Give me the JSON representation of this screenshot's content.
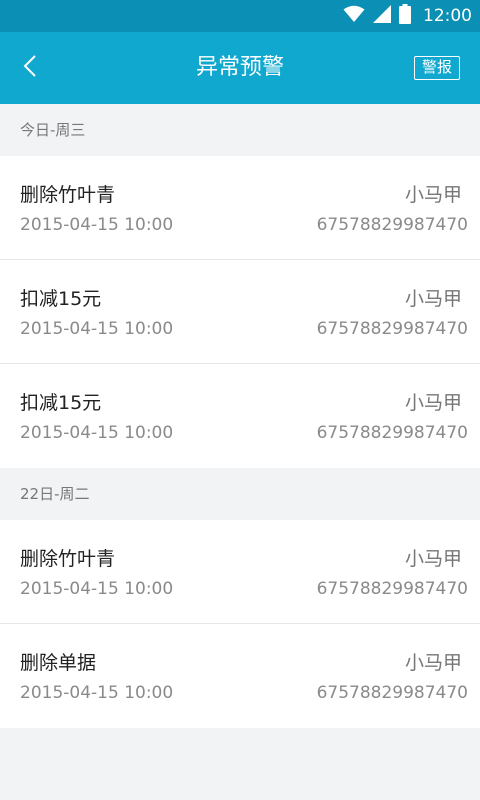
{
  "status_bar": {
    "time": "12:00",
    "icons": [
      "wifi-icon",
      "signal-icon",
      "battery-icon"
    ]
  },
  "app_bar": {
    "back_icon": "chevron-left-icon",
    "title": "异常预警",
    "action_label": "警报"
  },
  "sections": [
    {
      "header": "今日-周三",
      "items": [
        {
          "title": "删除竹叶青",
          "user": "小马甲",
          "time": "2015-04-15 10:00",
          "code": "67578829987470"
        },
        {
          "title": "扣减15元",
          "user": "小马甲",
          "time": "2015-04-15 10:00",
          "code": "67578829987470"
        },
        {
          "title": "扣减15元",
          "user": "小马甲",
          "time": "2015-04-15 10:00",
          "code": "67578829987470"
        }
      ]
    },
    {
      "header": "22日-周二",
      "items": [
        {
          "title": "删除竹叶青",
          "user": "小马甲",
          "time": "2015-04-15 10:00",
          "code": "67578829987470"
        },
        {
          "title": "删除单据",
          "user": "小马甲",
          "time": "2015-04-15 10:00",
          "code": "67578829987470"
        }
      ]
    }
  ],
  "colors": {
    "status_bar": "#0b8fb5",
    "app_bar": "#10a8cf",
    "background": "#f2f3f5"
  }
}
